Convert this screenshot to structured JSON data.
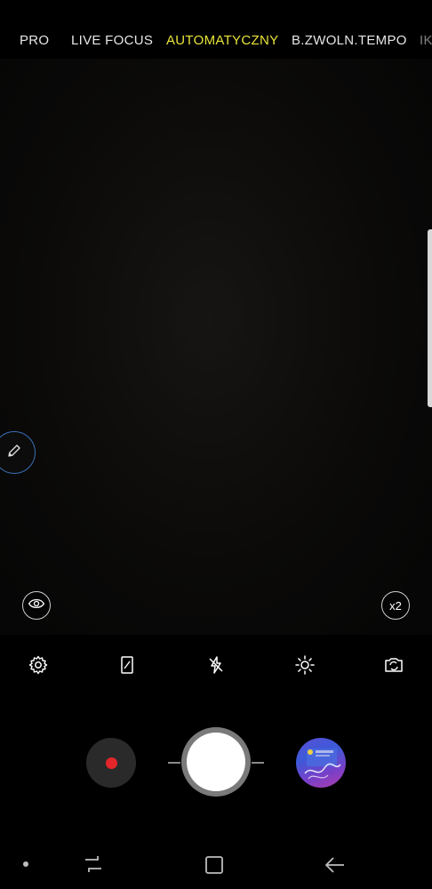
{
  "modes": {
    "items": [
      "PRO",
      "LIVE FOCUS",
      "AUTOMATYCZNY",
      "B.ZWOLN.TEMPO",
      "IK"
    ],
    "active": "AUTOMATYCZNY",
    "active_color": "#e8e33a"
  },
  "viewfinder": {
    "zoom_label": "x2",
    "edit_icon": "pencil-icon",
    "view_icon": "eye-icon"
  },
  "toolbar": {
    "icons": [
      "gear-icon",
      "aspect-ratio-icon",
      "flash-off-icon",
      "brightness-icon",
      "switch-camera-icon"
    ]
  },
  "capture": {
    "record_color": "#e3262a",
    "gallery_icon": "gallery-thumbnail"
  },
  "navbar": {
    "icons": [
      "dot-indicator-icon",
      "recent-apps-icon",
      "home-icon",
      "back-icon"
    ]
  }
}
